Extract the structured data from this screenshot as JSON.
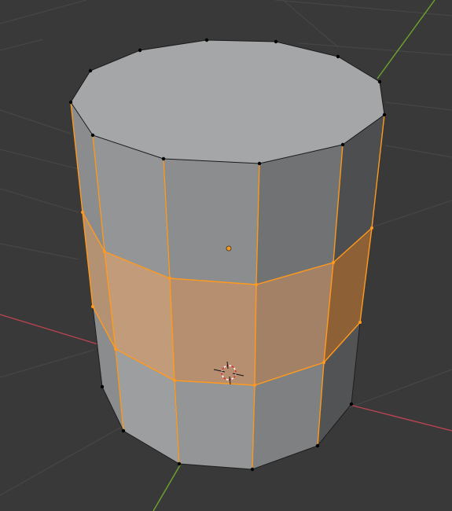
{
  "app": "Blender",
  "viewport": {
    "mode": "edit-mode",
    "object": "cylinder",
    "selection": "face-loop",
    "colors": {
      "background": "#393939",
      "grid": "#454545",
      "x_axis": "#b8444f",
      "y_axis": "#6ea52a",
      "selected_edge": "#ff9a1e",
      "selected_face": "#f2a163",
      "vertex": "#000000"
    }
  },
  "icons": {
    "origin": "object-origin-dot-icon",
    "cursor": "3d-cursor-icon"
  }
}
